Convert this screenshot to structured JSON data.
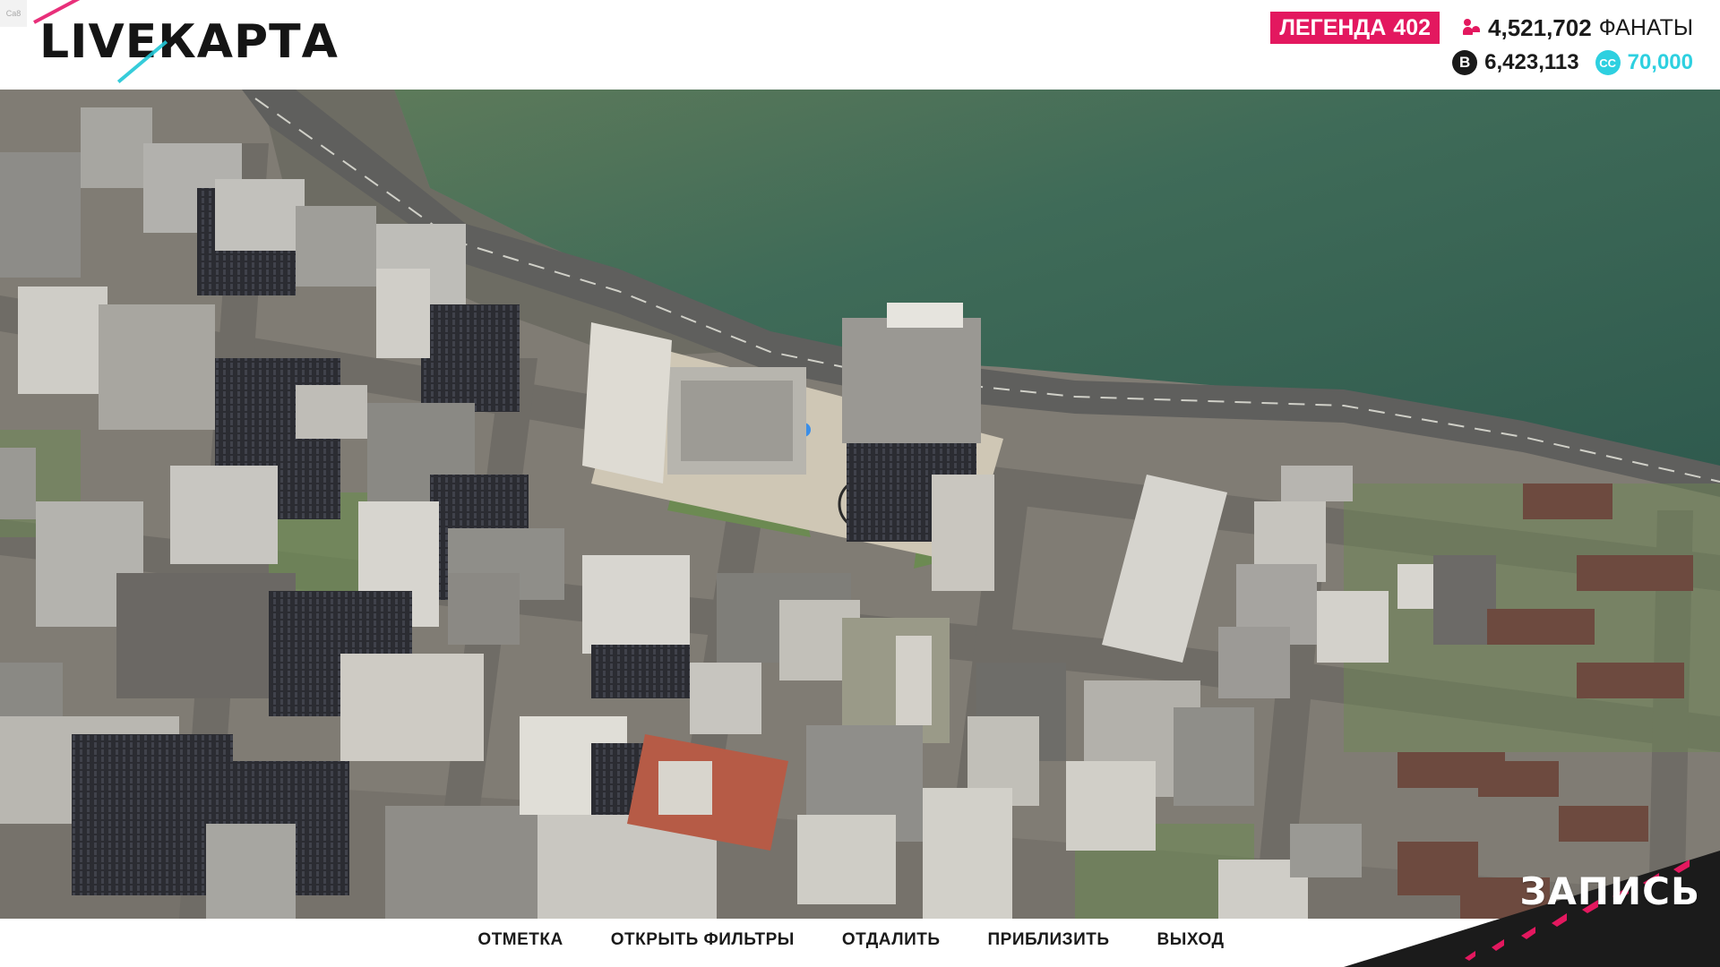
{
  "build_tag": "Ca8",
  "logo": {
    "live": "LIVE",
    "map": "КАРТА"
  },
  "stats": {
    "legend_label": "ЛЕГЕНДА",
    "legend_value": "402",
    "fans_value": "4,521,702",
    "fans_label": "ФАНАТЫ",
    "money_value": "6,423,113",
    "money_icon": "B",
    "cc_value": "70,000",
    "cc_icon": "CC"
  },
  "footer": {
    "buttons": [
      "ОТМЕТКА",
      "ОТКРЫТЬ ФИЛЬТРЫ",
      "ОТДАЛИТЬ",
      "ПРИБЛИЗИТЬ",
      "ВЫХОД"
    ]
  },
  "record_label": "ЗАПИСЬ",
  "colors": {
    "accent_pink": "#e3185f",
    "accent_cyan": "#2ed0e0",
    "water": "#3e6b55",
    "road": "#6e6c68"
  }
}
